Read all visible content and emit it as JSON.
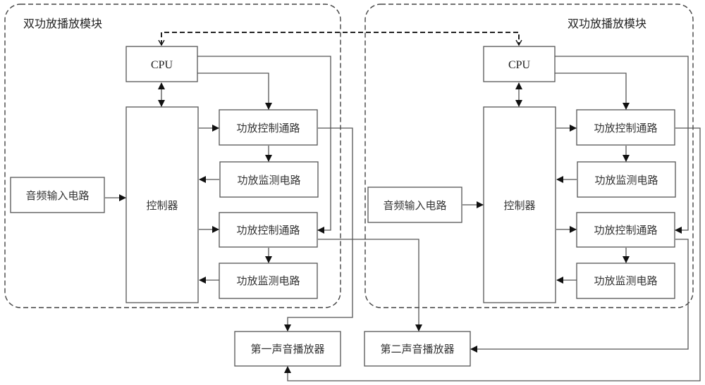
{
  "diagram": {
    "modules": [
      {
        "title": "双功放播放模块",
        "cpu": "CPU",
        "controller": "控制器",
        "audio_input": "音频输入电路",
        "amp_control_1": "功放控制通路",
        "amp_monitor_1": "功放监测电路",
        "amp_control_2": "功放控制通路",
        "amp_monitor_2": "功放监测电路"
      },
      {
        "title": "双功放播放模块",
        "cpu": "CPU",
        "controller": "控制器",
        "audio_input": "音频输入电路",
        "amp_control_1": "功放控制通路",
        "amp_monitor_1": "功放监测电路",
        "amp_control_2": "功放控制通路",
        "amp_monitor_2": "功放监测电路"
      }
    ],
    "players": {
      "first": "第一声音播放器",
      "second": "第二声音播放器"
    }
  }
}
